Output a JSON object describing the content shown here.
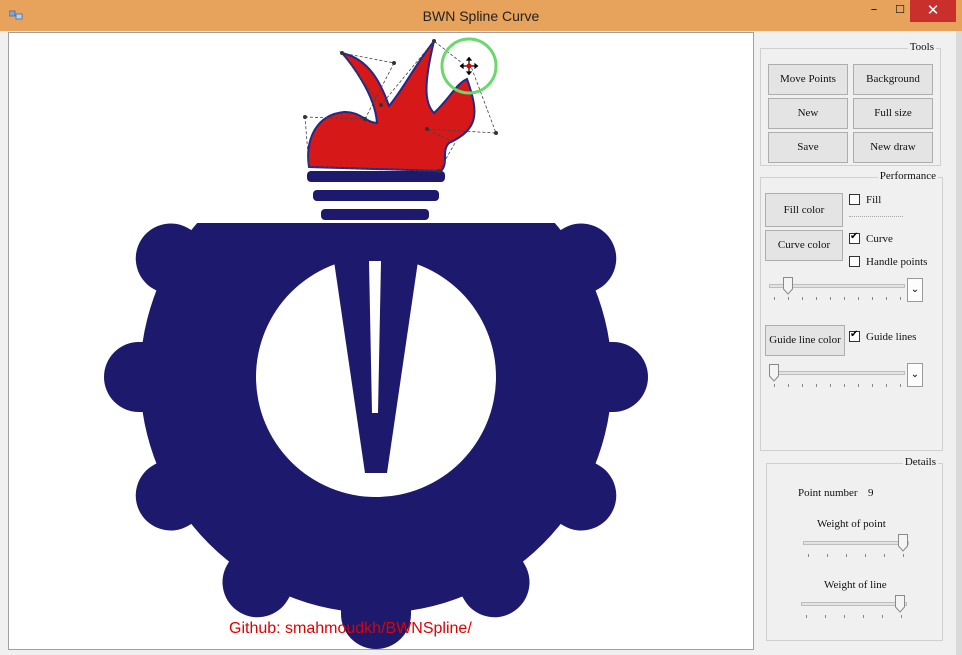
{
  "window": {
    "title": "BWN Spline Curve",
    "min_glyph": "–",
    "max_glyph": "☐",
    "close_glyph": "✕",
    "title_color": "#e7a25b"
  },
  "canvas": {
    "github_text": "Github: smahmoudkh/BWNSpline/",
    "logo_blue": "#1d1a6d",
    "flame_red": "#d61818"
  },
  "tools": {
    "title": "Tools",
    "buttons": {
      "move_points": "Move Points",
      "background": "Background",
      "new": "New",
      "full_size": "Full size",
      "save": "Save",
      "new_draw": "New draw"
    }
  },
  "performance": {
    "title": "Performance",
    "fill_color": "Fill color",
    "fill": {
      "label": "Fill",
      "checked": false
    },
    "curve_color": "Curve color",
    "curve": {
      "label": "Curve",
      "checked": true
    },
    "handle_points": {
      "label": "Handle points",
      "checked": false
    },
    "guide_line_color": "Guide line color",
    "guide_lines": {
      "label": "Guide lines",
      "checked": true
    },
    "dropdown_glyph": "⌄"
  },
  "details": {
    "title": "Details",
    "point_number_label": "Point number",
    "point_number_value": "9",
    "weight_of_point": "Weight of point",
    "weight_of_line": "Weight of line"
  }
}
